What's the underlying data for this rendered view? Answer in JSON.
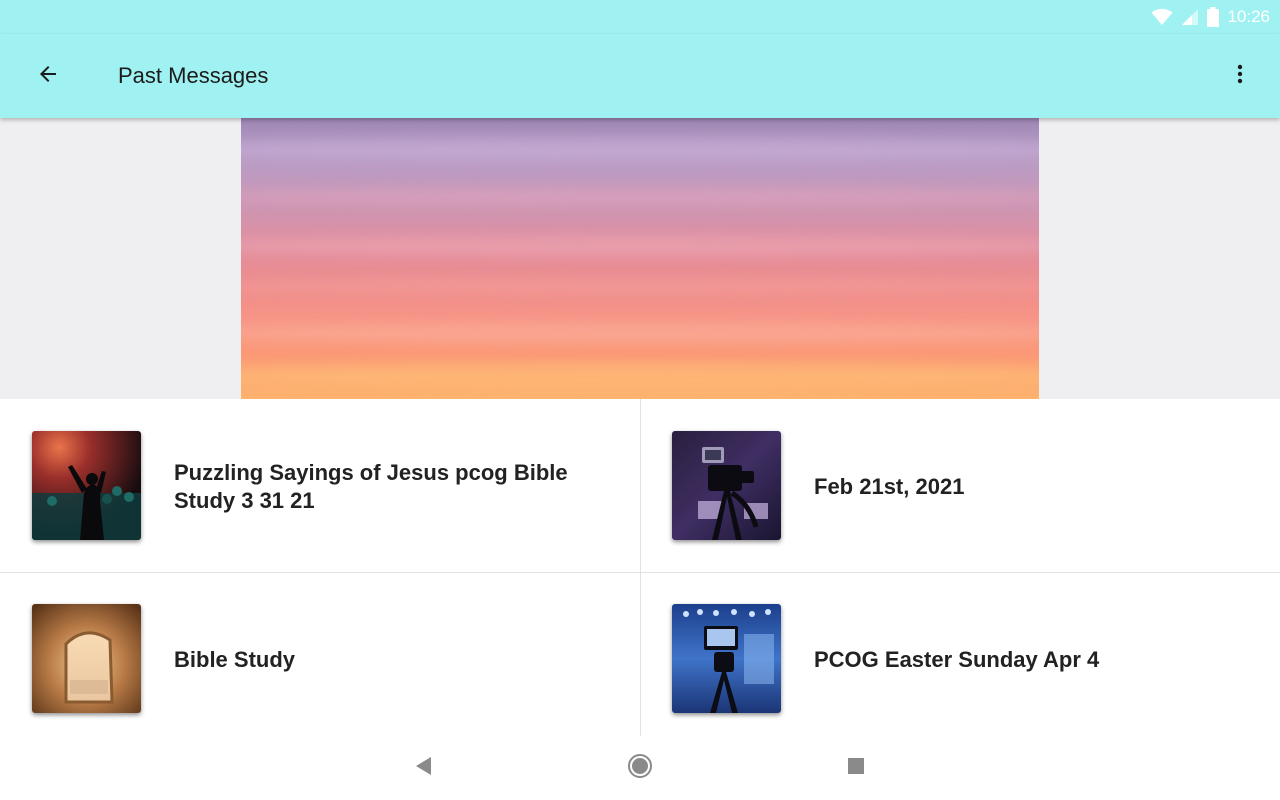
{
  "status_bar": {
    "time": "10:26",
    "icons": [
      "wifi-icon",
      "cellular-signal-icon",
      "battery-icon"
    ]
  },
  "app_bar": {
    "title": "Past Messages",
    "back_icon": "arrow-back-icon",
    "menu_icon": "more-vert-icon"
  },
  "colors": {
    "app_bar": "#a0f2f2",
    "hero_background": "#efeff1",
    "divider": "#e2e2e2",
    "text_primary": "#222222"
  },
  "messages": [
    {
      "title": "Puzzling Sayings of Jesus pcog Bible Study 3 31 21"
    },
    {
      "title": "Feb 21st, 2021"
    },
    {
      "title": "Bible Study"
    },
    {
      "title": "PCOG Easter Sunday Apr 4"
    }
  ],
  "nav_bar": {
    "buttons": [
      "nav-back-icon",
      "nav-home-icon",
      "nav-recents-icon"
    ]
  }
}
